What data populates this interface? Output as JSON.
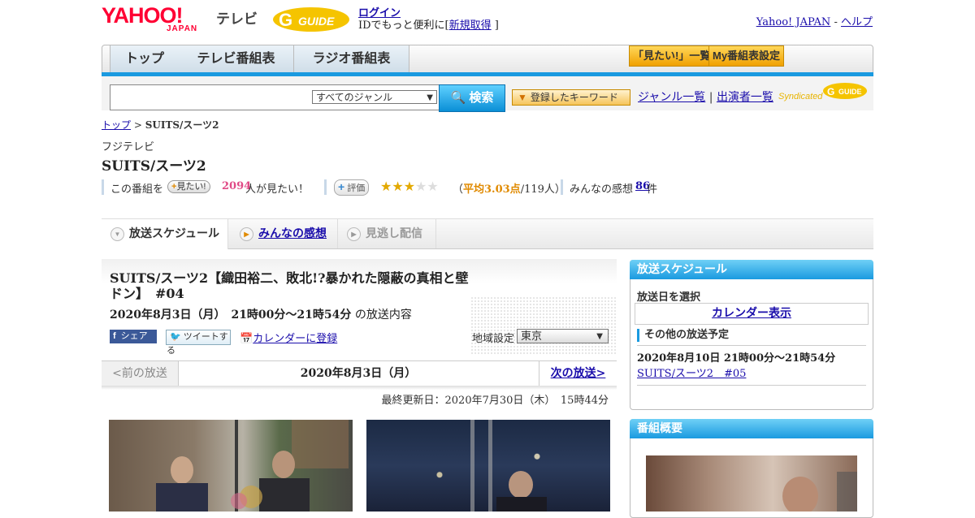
{
  "header": {
    "logo_yahoo": "YAHOO!",
    "logo_japan": "JAPAN",
    "logo_tv": "テレビ",
    "gguide_logo": "G-GUIDE",
    "login": "ログイン",
    "id_note_prefix": "IDでもっと便利に[",
    "signup": "新規取得",
    "id_note_suffix": "]",
    "yahoo_japan_link": "Yahoo! JAPAN",
    "separator": " - ",
    "help_link": "ヘルプ"
  },
  "nav": {
    "tabs": [
      "トップ",
      "テレビ番組表",
      "ラジオ番組表"
    ],
    "mitai_list": "「見たい!」一覧",
    "my_bangumi": "My番組表設定"
  },
  "search": {
    "genre_select": "すべてのジャンル",
    "search_button": "検索",
    "keyword_button": "登録したキーワード",
    "genre_list": "ジャンル一覧",
    "divider": "|",
    "performer_list": "出演者一覧",
    "syndicated": "Syndicated"
  },
  "breadcrumb": {
    "top": "トップ",
    "sep": " > ",
    "current": "SUITS/スーツ2"
  },
  "program": {
    "station": "フジテレビ",
    "title": "SUITS/スーツ2",
    "want_prefix": "この番組を",
    "want_button": "見たい!",
    "want_count": "2094",
    "want_suffix": "人が見たい！",
    "rate_button": "評価",
    "rating_stars": 3,
    "avg_open": "（",
    "avg_label": "平均3.03点",
    "avg_count": "/119人）",
    "comments_label": "みんなの感想",
    "comments_count": "86",
    "comments_suffix": "件"
  },
  "tabs": {
    "schedule": "放送スケジュール",
    "impressions": "みんなの感想",
    "streaming": "見逃し配信"
  },
  "episode": {
    "title": "SUITS/スーツ2【織田裕二、敗北!?暴かれた隠蔽の真相と壁ドン】　#04",
    "date": "2020年8月3日（月）　21時00分～21時54分",
    "date_suffix": "の放送内容",
    "share_fb": "シェア",
    "tweet": "ツイートする",
    "calendar_register": "カレンダーに登録",
    "region_label": "地域設定",
    "region_value": "東京",
    "prev": "<前の放送",
    "current_date": "2020年8月3日（月）",
    "next": "次の放送>",
    "updated": "最終更新日：2020年7月30日（木）　15時44分"
  },
  "sidebar": {
    "schedule_header": "放送スケジュール",
    "select_day": "放送日を選択",
    "calendar_show": "カレンダー表示",
    "other_schedule": "その他の放送予定",
    "other_date": "2020年8月10日  21時00分～21時54分",
    "other_link": "SUITS/スーツ2　#05",
    "summary_header": "番組概要"
  },
  "colors": {
    "yahoo_red": "#ff0033",
    "accent_blue": "#1a9ae0",
    "gguide_yellow": "#e8b400",
    "want_pink": "#e04a86",
    "star_gold": "#e3a900"
  }
}
